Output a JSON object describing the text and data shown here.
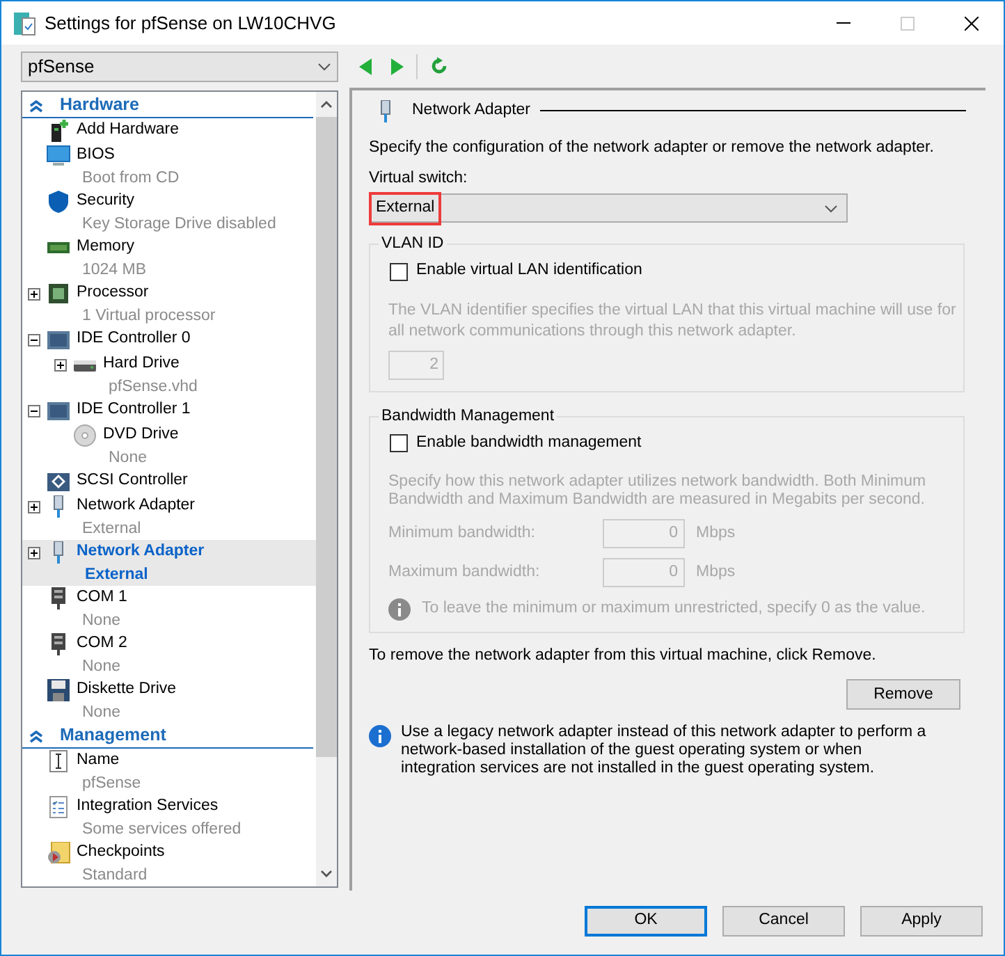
{
  "window": {
    "title": "Settings for pfSense on LW10CHVG"
  },
  "vm_selector": {
    "value": "pfSense"
  },
  "tree": [
    {
      "label": "Hardware",
      "expanded": true,
      "children": [
        {
          "kind": "add-hardware",
          "label": "Add Hardware",
          "selected": false
        },
        {
          "kind": "bios",
          "label": "BIOS",
          "sub": "Boot from CD",
          "selected": false
        },
        {
          "kind": "security",
          "label": "Security",
          "sub": "Key Storage Drive disabled",
          "selected": false
        },
        {
          "kind": "memory",
          "label": "Memory",
          "sub": "1024 MB",
          "selected": false
        },
        {
          "kind": "processor",
          "label": "Processor",
          "sub": "1 Virtual processor",
          "selected": false,
          "expanded": false
        },
        {
          "kind": "controller",
          "label": "IDE Controller 0",
          "selected": false,
          "expanded": true,
          "children": [
            {
              "kind": "hard-drive",
              "label": "Hard Drive",
              "sub": "pfSense.vhd",
              "selected": false,
              "expanded": false
            }
          ]
        },
        {
          "kind": "controller",
          "label": "IDE Controller 1",
          "selected": false,
          "expanded": true,
          "children": [
            {
              "kind": "dvd",
              "label": "DVD Drive",
              "sub": "None",
              "selected": false
            }
          ]
        },
        {
          "kind": "scsi",
          "label": "SCSI Controller",
          "selected": false
        },
        {
          "kind": "network",
          "label": "Network Adapter",
          "sub": "External",
          "selected": false,
          "expanded": false
        },
        {
          "kind": "network",
          "label": "Network Adapter",
          "sub": "External",
          "selected": true,
          "expanded": false
        },
        {
          "kind": "com",
          "label": "COM 1",
          "sub": "None",
          "selected": false
        },
        {
          "kind": "com",
          "label": "COM 2",
          "sub": "None",
          "selected": false
        },
        {
          "kind": "diskette",
          "label": "Diskette Drive",
          "sub": "None",
          "selected": false
        }
      ]
    },
    {
      "label": "Management",
      "expanded": true,
      "children": [
        {
          "kind": "name",
          "label": "Name",
          "sub": "pfSense",
          "selected": false
        },
        {
          "kind": "integration",
          "label": "Integration Services",
          "sub": "Some services offered",
          "selected": false
        },
        {
          "kind": "checkpoints",
          "label": "Checkpoints",
          "sub": "Standard",
          "selected": false
        }
      ]
    }
  ],
  "details": {
    "heading": "Network Adapter",
    "intro": "Specify the configuration of the network adapter or remove the network adapter.",
    "switch_label": "Virtual switch:",
    "switch_value": "External",
    "switch_highlighted": true,
    "vlan": {
      "title": "VLAN ID",
      "checkbox": {
        "label": "Enable virtual LAN identification",
        "checked": false
      },
      "description": "The VLAN identifier specifies the virtual LAN that this virtual machine will use for all network communications through this network adapter.",
      "value": "2"
    },
    "bandwidth": {
      "title": "Bandwidth Management",
      "checkbox": {
        "label": "Enable bandwidth management",
        "checked": false
      },
      "description": "Specify how this network adapter utilizes network bandwidth. Both Minimum Bandwidth and Maximum Bandwidth are measured in Megabits per second.",
      "fields": [
        {
          "label": "Minimum bandwidth:",
          "value": "0",
          "unit": "Mbps"
        },
        {
          "label": "Maximum bandwidth:",
          "value": "0",
          "unit": "Mbps"
        }
      ],
      "note": "To leave the minimum or maximum unrestricted, specify 0 as the value."
    },
    "remove_text": "To remove the network adapter from this virtual machine, click Remove.",
    "remove_button": "Remove",
    "info": "Use a legacy network adapter instead of this network adapter to perform a network-based installation of the guest operating system or when integration services are not installed in the guest operating system."
  },
  "buttons": [
    {
      "label": "OK",
      "default": true
    },
    {
      "label": "Cancel",
      "default": false
    },
    {
      "label": "Apply",
      "default": false
    }
  ]
}
